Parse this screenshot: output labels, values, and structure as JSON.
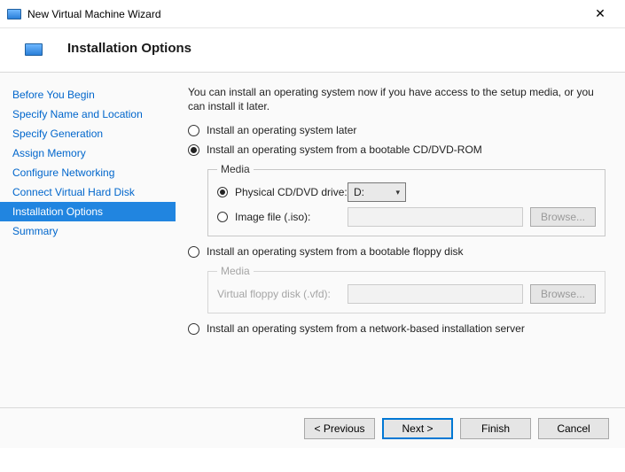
{
  "window": {
    "title": "New Virtual Machine Wizard"
  },
  "header": {
    "title": "Installation Options"
  },
  "sidebar": {
    "items": [
      {
        "label": "Before You Begin"
      },
      {
        "label": "Specify Name and Location"
      },
      {
        "label": "Specify Generation"
      },
      {
        "label": "Assign Memory"
      },
      {
        "label": "Configure Networking"
      },
      {
        "label": "Connect Virtual Hard Disk"
      },
      {
        "label": "Installation Options"
      },
      {
        "label": "Summary"
      }
    ],
    "active_index": 6
  },
  "content": {
    "intro": "You can install an operating system now if you have access to the setup media, or you can install it later.",
    "options": {
      "later": "Install an operating system later",
      "cddvd": "Install an operating system from a bootable CD/DVD-ROM",
      "floppy": "Install an operating system from a bootable floppy disk",
      "network": "Install an operating system from a network-based installation server"
    },
    "media_legend": "Media",
    "cd_media": {
      "physical_label": "Physical CD/DVD drive:",
      "drive_value": "D:",
      "image_label": "Image file (.iso):",
      "browse": "Browse..."
    },
    "floppy_media": {
      "vfd_label": "Virtual floppy disk (.vfd):",
      "browse": "Browse..."
    }
  },
  "footer": {
    "previous": "< Previous",
    "next": "Next >",
    "finish": "Finish",
    "cancel": "Cancel"
  }
}
